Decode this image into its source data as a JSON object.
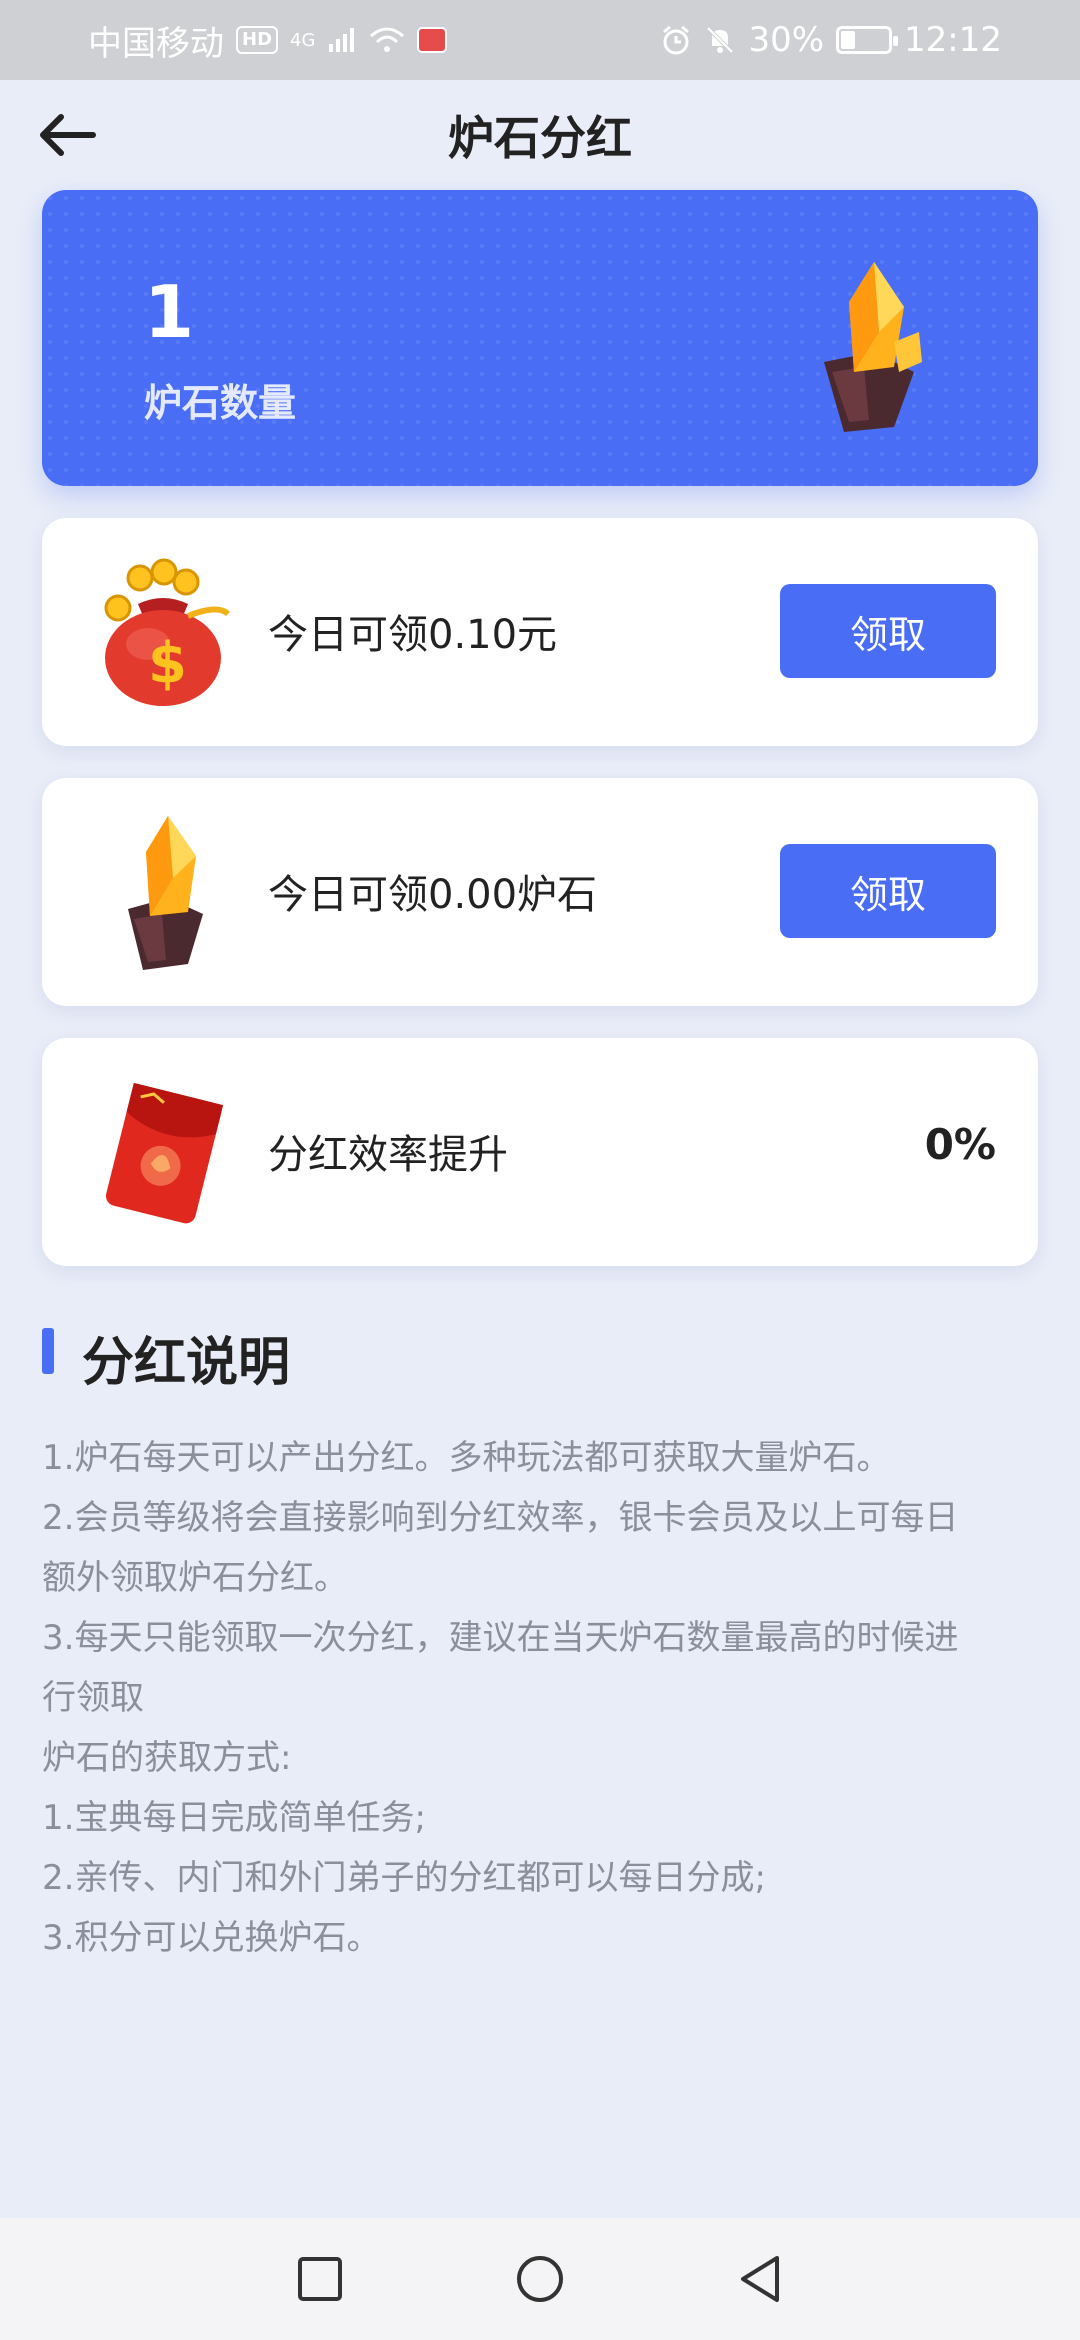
{
  "status_bar": {
    "carrier": "中国移动",
    "hd_badge": "HD",
    "network": "4G",
    "battery_percent": "30%",
    "time": "12:12",
    "battery_level": 0.3
  },
  "header": {
    "title": "炉石分红",
    "back_icon": "arrow-left-icon"
  },
  "hero": {
    "count": "1",
    "label": "炉石数量",
    "icon": "gem-stone-icon"
  },
  "cards": [
    {
      "icon": "money-bag-icon",
      "text": "今日可领0.10元",
      "button": "领取"
    },
    {
      "icon": "gem-stone-icon",
      "text": "今日可领0.00炉石",
      "button": "领取"
    },
    {
      "icon": "red-envelope-icon",
      "text": "分红效率提升",
      "value": "0%"
    }
  ],
  "explanation": {
    "title": "分红说明",
    "lines": [
      "1.炉石每天可以产出分红。多种玩法都可获取大量炉石。",
      "2.会员等级将会直接影响到分红效率，银卡会员及以上可每日",
      "额外领取炉石分红。",
      "3.每天只能领取一次分红，建议在当天炉石数量最高的时候进",
      "行领取",
      "炉石的获取方式:",
      "1.宝典每日完成简单任务;",
      "2.亲传、内门和外门弟子的分红都可以每日分成;",
      "3.积分可以兑换炉石。"
    ]
  },
  "nav": {
    "recent": "square-icon",
    "home": "circle-icon",
    "back": "triangle-back-icon"
  },
  "colors": {
    "accent": "#4a6df5",
    "background": "#e9edf8",
    "status_bar": "#cfd0d3"
  }
}
